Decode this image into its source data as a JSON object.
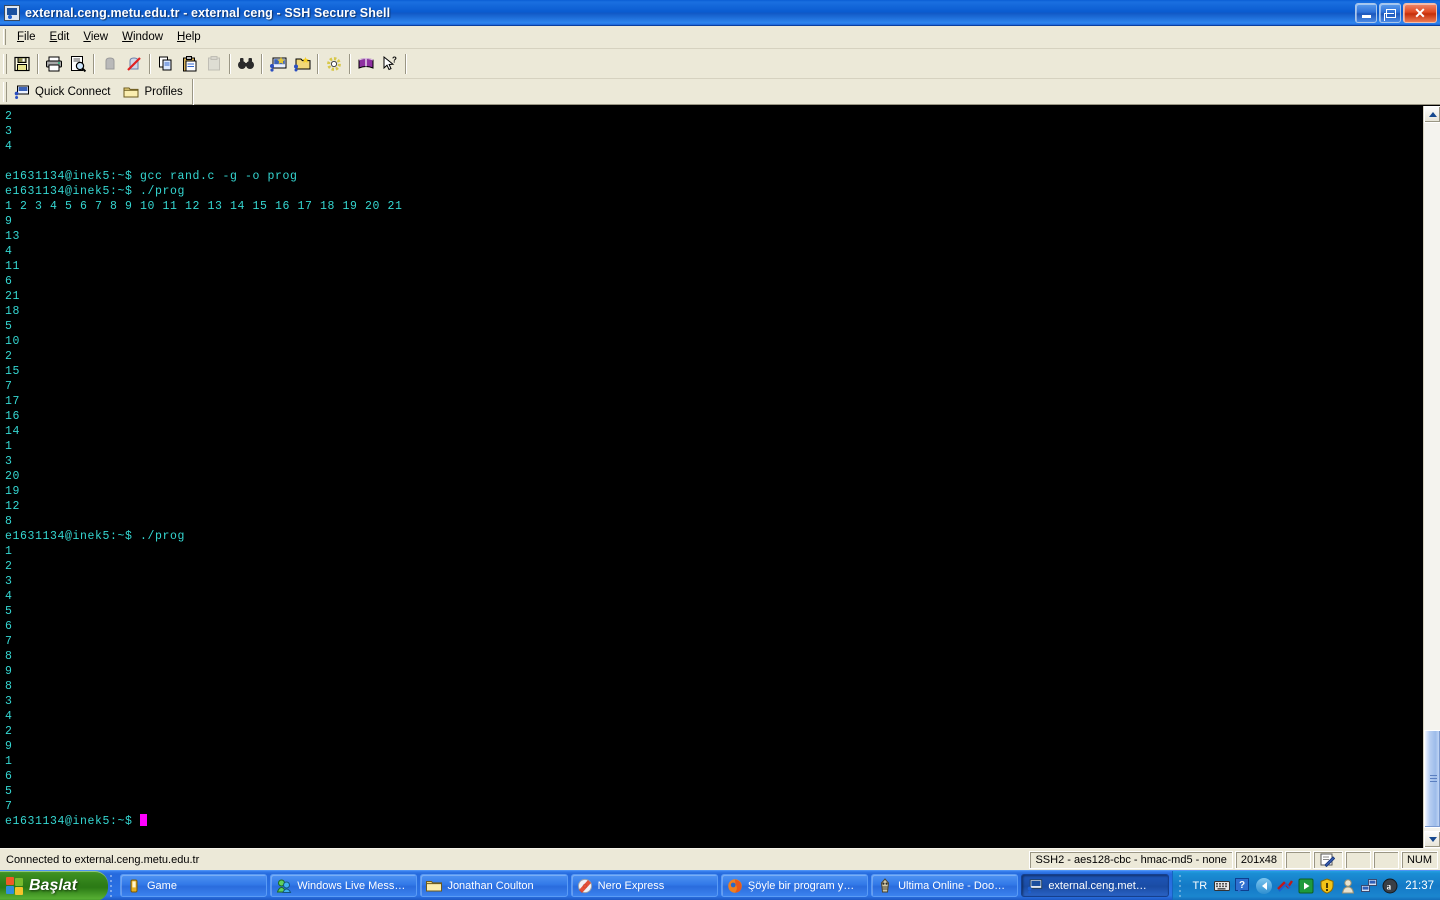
{
  "window": {
    "title": "external.ceng.metu.edu.tr - external ceng - SSH Secure Shell",
    "icon": "ssh-terminal-icon",
    "buttons": {
      "minimize": "_",
      "restore": "❐",
      "close": "✕"
    }
  },
  "menubar": {
    "items": [
      {
        "name": "file",
        "label": "File",
        "accel": "F"
      },
      {
        "name": "edit",
        "label": "Edit",
        "accel": "E"
      },
      {
        "name": "view",
        "label": "View",
        "accel": "V"
      },
      {
        "name": "window",
        "label": "Window",
        "accel": "W"
      },
      {
        "name": "help",
        "label": "Help",
        "accel": "H"
      }
    ]
  },
  "toolbar": {
    "buttons": [
      {
        "name": "save-icon",
        "title": "Save"
      },
      {
        "name": "print-icon",
        "title": "Print"
      },
      {
        "name": "print-preview-icon",
        "title": "Print Preview"
      },
      {
        "name": "connect-icon",
        "title": "Connect"
      },
      {
        "name": "disconnect-icon",
        "title": "Disconnect"
      },
      {
        "name": "copy-icon",
        "title": "Copy"
      },
      {
        "name": "paste-icon",
        "title": "Paste"
      },
      {
        "name": "delete-icon",
        "title": "Delete"
      },
      {
        "name": "find-icon",
        "title": "Find"
      },
      {
        "name": "new-terminal-icon",
        "title": "New Terminal Window"
      },
      {
        "name": "new-filetransfer-icon",
        "title": "New File Transfer Window"
      },
      {
        "name": "settings-icon",
        "title": "Settings"
      },
      {
        "name": "help-book-icon",
        "title": "Help"
      },
      {
        "name": "context-help-icon",
        "title": "Context Help"
      }
    ]
  },
  "quickbar": {
    "quick_connect_label": "Quick Connect",
    "quick_connect_icon": "quick-connect-icon",
    "profiles_label": "Profiles",
    "profiles_icon": "profiles-folder-icon"
  },
  "terminal": {
    "foreground_color": "#35d7d2",
    "background_color": "#000000",
    "cursor_color": "#ff00ff",
    "prompt": "e1631134@inek5:~$",
    "lines": [
      "2",
      "3",
      "4",
      "",
      "e1631134@inek5:~$ gcc rand.c -g -o prog",
      "e1631134@inek5:~$ ./prog",
      "1 2 3 4 5 6 7 8 9 10 11 12 13 14 15 16 17 18 19 20 21",
      "9",
      "13",
      "4",
      "11",
      "6",
      "21",
      "18",
      "5",
      "10",
      "2",
      "15",
      "7",
      "17",
      "16",
      "14",
      "1",
      "3",
      "20",
      "19",
      "12",
      "8",
      "e1631134@inek5:~$ ./prog",
      "1",
      "2",
      "3",
      "4",
      "5",
      "6",
      "7",
      "8",
      "9",
      "8",
      "3",
      "4",
      "2",
      "9",
      "1",
      "6",
      "5",
      "7"
    ],
    "last_prompt": "e1631134@inek5:~$ "
  },
  "scrollbar": {
    "up_arrow": "scroll-up-arrow",
    "down_arrow": "scroll-down-arrow",
    "thumb": "scroll-thumb"
  },
  "statusbar": {
    "connection": "Connected to external.ceng.metu.edu.tr",
    "cipher": "SSH2 - aes128-cbc - hmac-md5 - none",
    "size": "201x48",
    "num": "NUM"
  },
  "taskbar": {
    "start_label": "Başlat",
    "start_icon": "windows-flag-icon",
    "tasks": [
      {
        "name": "task-game",
        "label": "Game",
        "icon": "game-icon",
        "active": false
      },
      {
        "name": "task-msn",
        "label": "Windows Live Mess…",
        "icon": "messenger-icon",
        "active": false
      },
      {
        "name": "task-folder",
        "label": "Jonathan Coulton",
        "icon": "folder-icon",
        "active": false
      },
      {
        "name": "task-nero",
        "label": "Nero Express",
        "icon": "nero-icon",
        "active": false
      },
      {
        "name": "task-firefox",
        "label": "Şöyle bir program y…",
        "icon": "firefox-icon",
        "active": false
      },
      {
        "name": "task-ultima",
        "label": "Ultima Online - Doo…",
        "icon": "ultima-icon",
        "active": false
      },
      {
        "name": "task-ssh",
        "label": "external.ceng.met…",
        "icon": "ssh-terminal-icon",
        "active": true
      }
    ],
    "tray": {
      "language": "TR",
      "clock": "21:37",
      "icons": [
        {
          "name": "keyboard-icon"
        },
        {
          "name": "help-question-icon"
        },
        {
          "name": "show-hidden-icons-chevron"
        },
        {
          "name": "network-icon"
        },
        {
          "name": "media-icon"
        },
        {
          "name": "security-shield-icon"
        },
        {
          "name": "user-icon"
        },
        {
          "name": "network-connection-icon"
        },
        {
          "name": "antivirus-icon"
        }
      ]
    }
  }
}
